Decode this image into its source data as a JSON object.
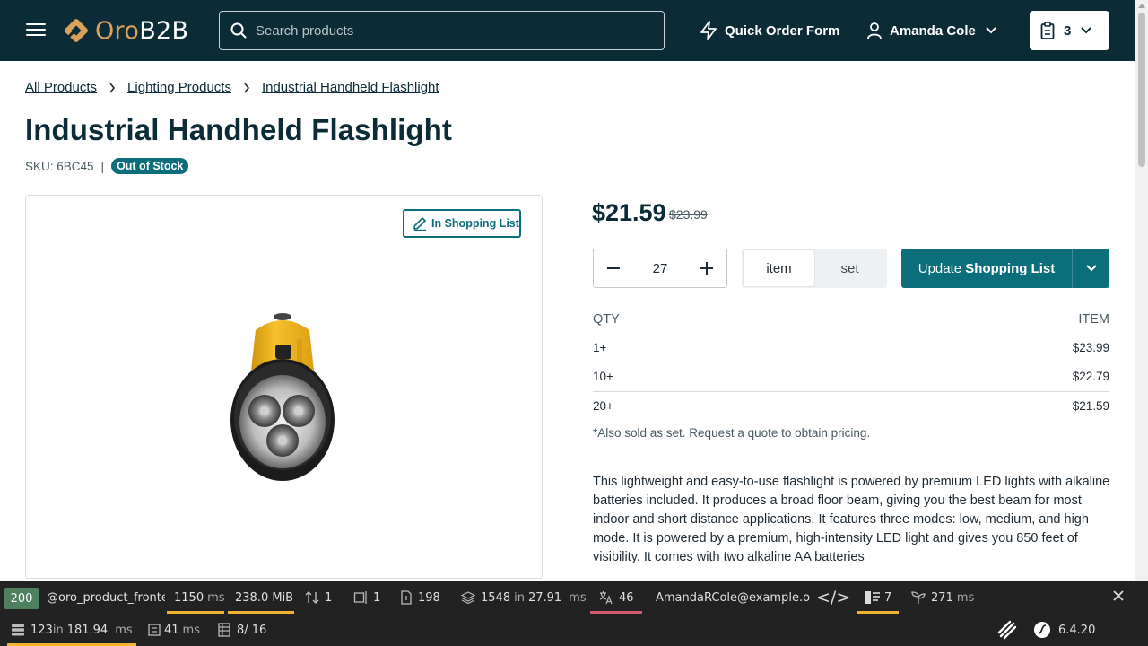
{
  "header": {
    "logo_prefix": "Oro",
    "logo_suffix": "B2B",
    "search_placeholder": "Search products",
    "quick_order_label": "Quick Order Form",
    "user_name": "Amanda Cole",
    "cart_count": "3"
  },
  "breadcrumb": [
    "All Products",
    "Lighting Products",
    "Industrial Handheld Flashlight"
  ],
  "product": {
    "title": "Industrial Handheld Flashlight",
    "sku": "SKU: 6BC45",
    "separator": "|",
    "stock_badge": "Out of Stock",
    "in_list_label": "In Shopping List",
    "price": "$21.59",
    "old_price": "$23.99",
    "quantity": "27",
    "unit_item": "item",
    "unit_set": "set",
    "update_label_1": "Update ",
    "update_label_2": "Shopping List",
    "tier_head_qty": "QTY",
    "tier_head_item": "ITEM",
    "tiers": [
      {
        "qty": "1+",
        "price": "$23.99"
      },
      {
        "qty": "10+",
        "price": "$22.79"
      },
      {
        "qty": "20+",
        "price": "$21.59"
      }
    ],
    "note": "*Also sold as set. Request a quote to obtain pricing.",
    "description": "This lightweight and easy-to-use flashlight is powered by premium LED lights with alkaline batteries included. It produces a broad floor beam, giving you the best beam for most indoor and short distance applications. It features three modes: low, medium, and high mode. It is powered by a premium, high-intensity LED light and gives you 850 feet of visibility. It comes with two alkaline AA batteries"
  },
  "debug_toolbar": {
    "status": "200",
    "route": "@oro_product_fronte",
    "time": "1150",
    "time_unit": "ms",
    "memory": "238.0 MiB",
    "requests": "1",
    "forms": "1",
    "logs": "198",
    "events": "1548",
    "events_in": "in",
    "events_time": "27.91",
    "events_unit": "ms",
    "translations": "46",
    "user": "AmandaRCole@example.o",
    "twig": "7",
    "twig_time": "271",
    "twig_unit": "ms",
    "db_queries": "123",
    "db_in": "in",
    "db_time": "181.94",
    "db_unit": "ms",
    "cache_time": "41",
    "cache_unit": "ms",
    "layout": "8/ 16",
    "version": "6.4.20",
    "colors": {
      "status_ok": "#4f805d",
      "warning_bar": "#f3b130",
      "error_bar": "#d45b6e"
    }
  },
  "colors": {
    "header_bg": "#0b2b36",
    "accent": "#0c6d7b",
    "logo_gold": "#d9a15b"
  }
}
